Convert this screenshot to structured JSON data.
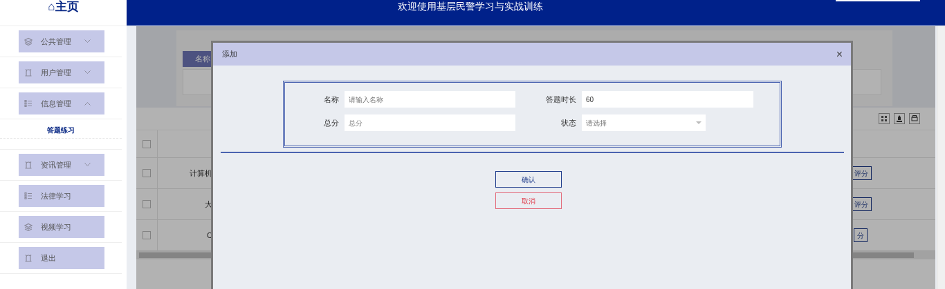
{
  "logo": "⌂主页",
  "header": {
    "title": "欢迎使用基层民警学习与实战训练"
  },
  "sidebar": {
    "items": [
      {
        "kind": "group",
        "label": "公共管理",
        "expanded": false
      },
      {
        "kind": "group",
        "label": "用户管理",
        "expanded": false
      },
      {
        "kind": "group",
        "label": "信息管理",
        "expanded": true,
        "children": [
          {
            "label": "答题练习",
            "selected": true
          }
        ]
      },
      {
        "kind": "group",
        "label": "资讯管理",
        "expanded": false
      },
      {
        "kind": "link",
        "label": "法律学习"
      },
      {
        "kind": "link",
        "label": "视频学习"
      },
      {
        "kind": "link",
        "label": "退出"
      }
    ]
  },
  "background_page": {
    "search_label": "名称",
    "table": {
      "select_all": {
        "checked": false
      },
      "rows": [
        {
          "checked": false,
          "name": "计算机",
          "action": "评分"
        },
        {
          "checked": false,
          "name": "大",
          "action": "评分"
        },
        {
          "checked": false,
          "name": "C",
          "action": "分"
        }
      ]
    }
  },
  "dialog": {
    "title": "添加",
    "close": "×",
    "fields": [
      {
        "label": "名称",
        "kind": "text",
        "placeholder": "请输入名称"
      },
      {
        "label": "答题时长",
        "kind": "text",
        "value": "60"
      },
      {
        "label": "总分",
        "kind": "text",
        "placeholder": "总分"
      },
      {
        "label": "状态",
        "kind": "select",
        "placeholder": "请选择"
      }
    ],
    "buttons": [
      {
        "label": "确认",
        "kind": "primary"
      },
      {
        "label": "取消",
        "kind": "danger"
      }
    ]
  }
}
